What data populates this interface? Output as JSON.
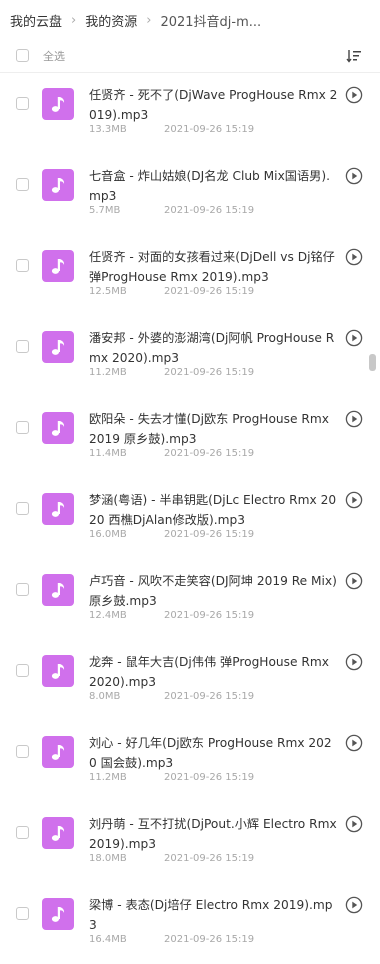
{
  "breadcrumb": [
    "我的云盘",
    "我的资源",
    "2021抖音dj-m..."
  ],
  "header": {
    "select_all": "全选",
    "sort_icon": "sort-icon"
  },
  "files": [
    {
      "name": "任贤齐 - 死不了(DjWave ProgHouse Rmx 2019).mp3",
      "size": "13.3MB",
      "date": "2021-09-26 15:19"
    },
    {
      "name": "七音盒 - 炸山姑娘(DJ名龙 Club Mix国语男).mp3",
      "size": "5.7MB",
      "date": "2021-09-26 15:19"
    },
    {
      "name": "任贤齐 - 对面的女孩看过来(DjDell vs Dj铭仔 弹ProgHouse Rmx 2019).mp3",
      "size": "12.5MB",
      "date": "2021-09-26 15:19"
    },
    {
      "name": "潘安邦 - 外婆的澎湖湾(Dj阿帆 ProgHouse Rmx 2020).mp3",
      "size": "11.2MB",
      "date": "2021-09-26 15:19"
    },
    {
      "name": "欧阳朵 - 失去才懂(Dj欧东 ProgHouse Rmx 2019 原乡鼓).mp3",
      "size": "11.4MB",
      "date": "2021-09-26 15:19"
    },
    {
      "name": "梦涵(粤语) - 半串钥匙(DjLc Electro Rmx 2020 西樵DjAlan修改版).mp3",
      "size": "16.0MB",
      "date": "2021-09-26 15:19"
    },
    {
      "name": "卢巧音 - 风吹不走笑容(DJ阿坤 2019 Re Mix)原乡鼓.mp3",
      "size": "12.4MB",
      "date": "2021-09-26 15:19"
    },
    {
      "name": "龙奔 - 鼠年大吉(Dj伟伟 弹ProgHouse Rmx 2020).mp3",
      "size": "8.0MB",
      "date": "2021-09-26 15:19"
    },
    {
      "name": "刘心 - 好几年(Dj欧东 ProgHouse Rmx 2020 国会鼓).mp3",
      "size": "11.2MB",
      "date": "2021-09-26 15:19"
    },
    {
      "name": "刘丹萌 - 互不打扰(DjPout.小辉 Electro Rmx 2019).mp3",
      "size": "18.0MB",
      "date": "2021-09-26 15:19"
    },
    {
      "name": "梁博 - 表态(Dj培仔 Electro Rmx 2019).mp3",
      "size": "16.4MB",
      "date": "2021-09-26 15:19"
    }
  ],
  "icons": {
    "file": "music-note-icon",
    "action": "play-circle-icon"
  },
  "colors": {
    "file_icon_bg": "#d070ec",
    "meta_text": "#a8a8a8"
  }
}
